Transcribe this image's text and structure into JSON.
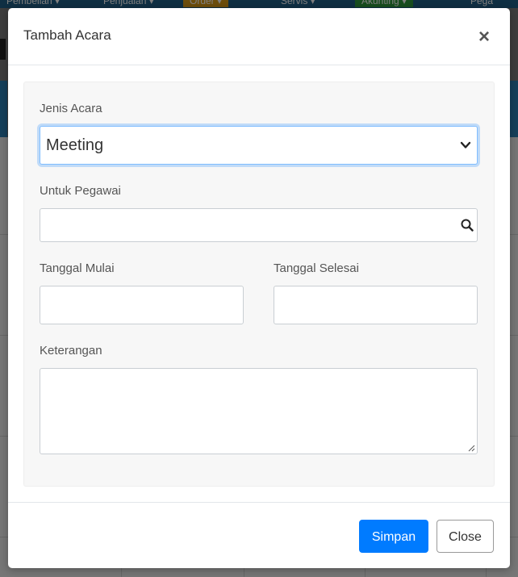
{
  "background": {
    "nav_items": [
      {
        "label": "Pembelian ▾",
        "color": "#1f5f86"
      },
      {
        "label": "Penjualan ▾",
        "color": "#1f5f86"
      },
      {
        "label": "Order ▾",
        "color": "#d89a16"
      },
      {
        "label": "Servis ▾",
        "color": "#1f5f86"
      },
      {
        "label": "Akunting ▾",
        "color": "#2e9b3d"
      },
      {
        "label": "Pega",
        "color": "#1f5f86"
      }
    ]
  },
  "modal": {
    "title": "Tambah Acara",
    "close_icon": "close-icon",
    "fields": {
      "event_type": {
        "label": "Jenis Acara",
        "value": "Meeting"
      },
      "employee": {
        "label": "Untuk Pegawai",
        "value": "",
        "icon": "search-icon"
      },
      "start_date": {
        "label": "Tanggal Mulai",
        "value": ""
      },
      "end_date": {
        "label": "Tanggal Selesai",
        "value": ""
      },
      "notes": {
        "label": "Keterangan",
        "value": ""
      }
    },
    "footer": {
      "save_label": "Simpan",
      "close_label": "Close"
    }
  },
  "colors": {
    "primary": "#007bff",
    "focus_border": "#80bdff",
    "panel_bg": "#f7f7f7"
  }
}
